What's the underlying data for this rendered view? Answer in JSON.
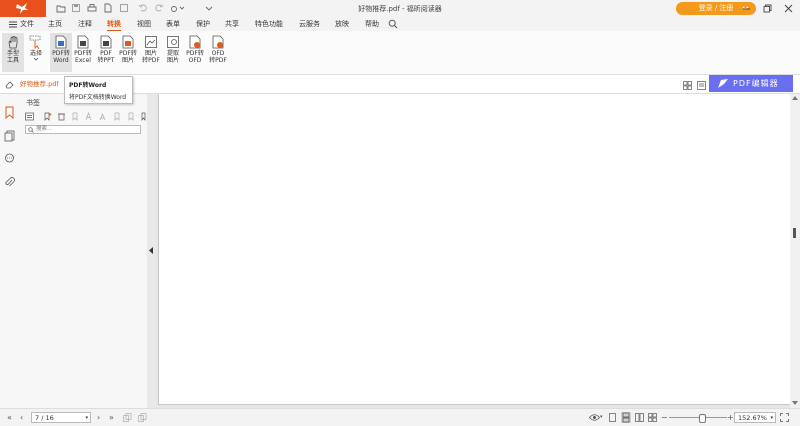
{
  "window": {
    "title": "好物推荐.pdf - 福昕阅读器",
    "login_label": "登录 / 注册"
  },
  "menu": {
    "file_label": "文件",
    "items": [
      "主页",
      "注释",
      "转换",
      "视图",
      "表单",
      "保护",
      "共享",
      "特色功能",
      "云服务",
      "放映",
      "帮助"
    ],
    "active_index": 2
  },
  "ribbon": {
    "buttons": [
      {
        "label": "手型\n工具",
        "icon": "hand-icon"
      },
      {
        "label": "选择",
        "icon": "select-cursor-icon"
      },
      {
        "label": "PDF转\nWord",
        "icon": "pdf-to-word-icon"
      },
      {
        "label": "PDF转\nExcel",
        "icon": "pdf-to-excel-icon"
      },
      {
        "label": "PDF\n转PPT",
        "icon": "pdf-to-ppt-icon"
      },
      {
        "label": "PDF转\n图片",
        "icon": "pdf-to-image-icon"
      },
      {
        "label": "图片\n转PDF",
        "icon": "image-to-pdf-icon"
      },
      {
        "label": "提取\n图片",
        "icon": "extract-image-icon"
      },
      {
        "label": "PDF转\nOFD",
        "icon": "pdf-to-ofd-icon"
      },
      {
        "label": "OFD\n转PDF",
        "icon": "ofd-to-pdf-icon"
      }
    ]
  },
  "tooltip": {
    "title": "PDF转Word",
    "description": "将PDF文档转换Word"
  },
  "tabs": {
    "doc_tab": "好物推荐.pdf"
  },
  "banner": {
    "label": "PDF编辑器",
    "color": "#6a6ef0"
  },
  "bookmarks": {
    "title": "书签",
    "search_placeholder": "搜索..."
  },
  "status": {
    "page_value": "7 / 16",
    "zoom_value": "152.67%"
  },
  "colors": {
    "accent": "#e05a1e",
    "logo": "#e8501e",
    "login": "#f39a1c"
  }
}
